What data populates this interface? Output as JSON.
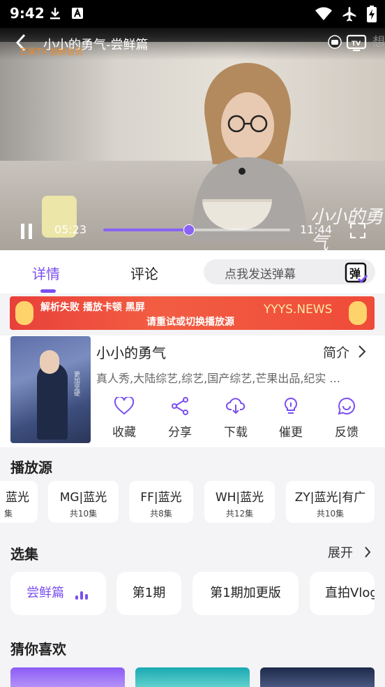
{
  "status_bar": {
    "time": "9:42"
  },
  "player": {
    "title": "小小的勇气-尝鲜篇",
    "logo_text": "芒果TV 尝鲜会员",
    "watermark_right": "想",
    "current_time": "05:23",
    "total_time": "11:44",
    "progress_fraction": 0.4577,
    "accent_color": "#8a62f5",
    "show_watermark": "小小的勇气"
  },
  "tabs": {
    "detail": "详情",
    "comment": "评论",
    "danmaku_placeholder": "点我发送弹幕",
    "danmaku_icon_text": "弹"
  },
  "banner": {
    "line1": "解析失败  播放卡顿  黑屏",
    "line2": "请重试或切换播放源",
    "site": "YYYS.NEWS"
  },
  "show": {
    "title": "小小的勇气",
    "intro_label": "简介",
    "tags": "真人秀,大陆综艺,综艺,国产综艺,芒果出品,纪实 ...",
    "poster_text": "更加坚硬",
    "actions": [
      {
        "label": "收藏",
        "icon": "heart-icon"
      },
      {
        "label": "分享",
        "icon": "share-icon"
      },
      {
        "label": "下载",
        "icon": "download-icon"
      },
      {
        "label": "催更",
        "icon": "lightbulb-icon"
      },
      {
        "label": "反馈",
        "icon": "feedback-icon"
      }
    ]
  },
  "sources": {
    "title": "播放源",
    "items": [
      {
        "name": "蓝光",
        "count": "集"
      },
      {
        "name": "MG|蓝光",
        "count": "共10集"
      },
      {
        "name": "FF|蓝光",
        "count": "共8集"
      },
      {
        "name": "WH|蓝光",
        "count": "共12集"
      },
      {
        "name": "ZY|蓝光|有广",
        "count": "共10集"
      }
    ]
  },
  "episodes": {
    "title": "选集",
    "expand_label": "展开",
    "items": [
      "尝鲜篇",
      "第1期",
      "第1期加更版",
      "直拍Vlog"
    ]
  },
  "recommend": {
    "title": "猜你喜欢"
  }
}
